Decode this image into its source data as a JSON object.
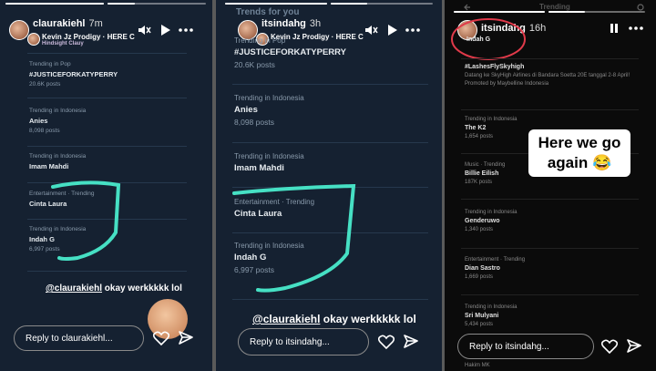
{
  "panel1": {
    "username": "claurakiehl",
    "time_ago": "7m",
    "music": "Kevin Jz Prodigy · HERE C",
    "music_sub": "Hindsight Clauy",
    "trends": [
      {
        "label": "Trending in Pop",
        "name": "#JUSTICEFORKATYPERRY",
        "posts": "20.6K posts"
      },
      {
        "label": "Trending in Indonesia",
        "name": "Anies",
        "posts": "8,098 posts"
      },
      {
        "label": "Trending in Indonesia",
        "name": "Imam Mahdi",
        "posts": ""
      },
      {
        "label": "Entertainment · Trending",
        "name": "Cinta Laura",
        "posts": ""
      },
      {
        "label": "Trending in Indonesia",
        "name": "Indah G",
        "posts": "6,997 posts"
      }
    ],
    "mention_handle": "@claurakiehl",
    "mention_text": " okay werkkkkk lol",
    "reply_placeholder": "Reply to claurakiehl..."
  },
  "panel2": {
    "header_partial": "Trends for you",
    "username": "itsindahg",
    "time_ago": "3h",
    "music": "Kevin Jz Prodigy · HERE C",
    "trends": [
      {
        "label": "Trending in Pop",
        "name": "#JUSTICEFORKATYPERRY",
        "posts": "20.6K posts"
      },
      {
        "label": "Trending in Indonesia",
        "name": "Anies",
        "posts": "8,098 posts"
      },
      {
        "label": "Trending in Indonesia",
        "name": "Imam Mahdi",
        "posts": ""
      },
      {
        "label": "Entertainment · Trending",
        "name": "Cinta Laura",
        "posts": ""
      },
      {
        "label": "Trending in Indonesia",
        "name": "Indah G",
        "posts": "6,997 posts"
      }
    ],
    "mention_handle": "@claurakiehl",
    "mention_text": " okay werkkkkk lol",
    "reply_placeholder": "Reply to itsindahg..."
  },
  "panel3": {
    "header_partial": "Trending",
    "username": "itsindahg",
    "time_ago": "16h",
    "highlight": "Indah G",
    "promo_name": "#LashesFlySkyhigh",
    "promo_desc": "Datang ke SkyHigh Airlines di Bandara Soetta 20E tanggal 2-8 April!",
    "promo_by": "Promoted by Maybelline Indonesia",
    "trends": [
      {
        "label": "Trending in Indonesia",
        "name": "The K2",
        "posts": "1,654 posts"
      },
      {
        "label": "Music · Trending",
        "name": "Billie Eilish",
        "posts": "187K posts"
      },
      {
        "label": "Trending in Indonesia",
        "name": "Genderuwo",
        "posts": "1,340 posts"
      },
      {
        "label": "Entertainment · Trending",
        "name": "Dian Sastro",
        "posts": "1,669 posts"
      },
      {
        "label": "Trending in Indonesia",
        "name": "Sri Mulyani",
        "posts": "5,434 posts"
      }
    ],
    "bottom_partial": "Hakim MK",
    "sticker_text": "Here we go again 😂",
    "reply_placeholder": "Reply to itsindahg..."
  },
  "icons": [
    "mute-icon",
    "play-icon",
    "pause-icon",
    "more-icon",
    "heart-icon",
    "send-icon",
    "close-icon",
    "settings-icon",
    "back-icon"
  ],
  "colors": {
    "panel_bg": "#152131",
    "scribble": "#46e0c4",
    "circle": "#e03a4a"
  }
}
